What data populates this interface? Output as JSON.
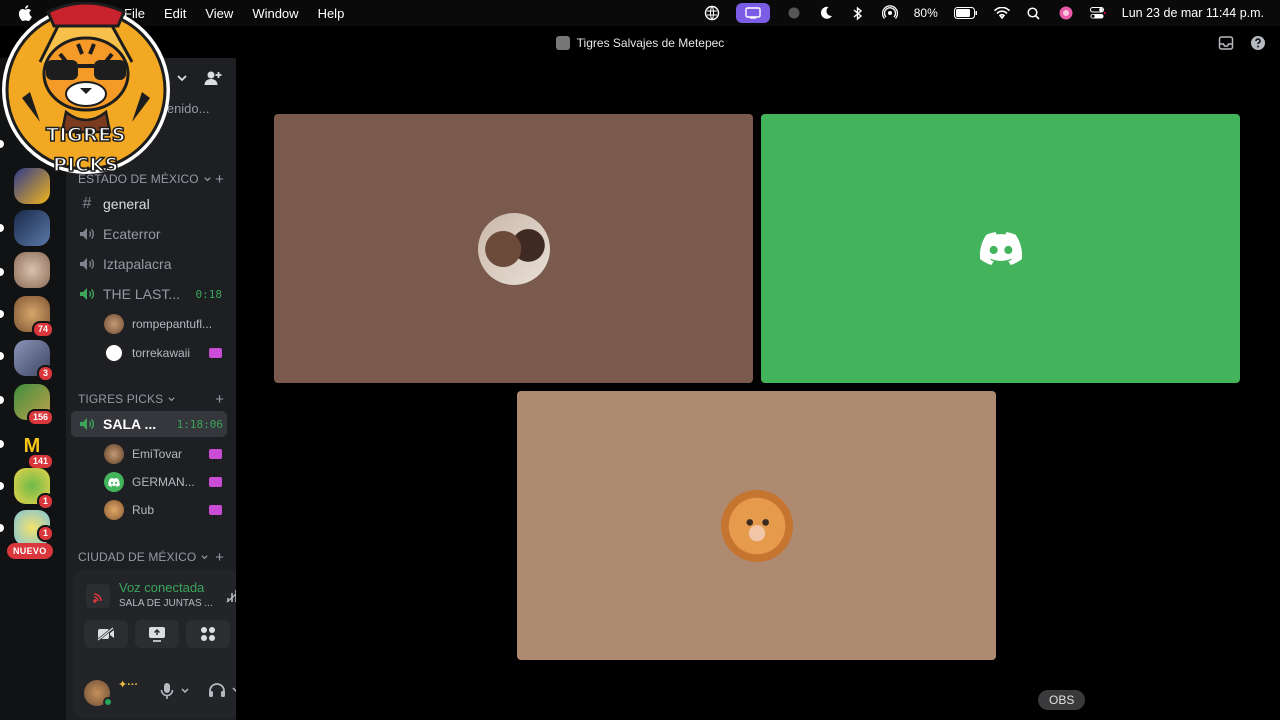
{
  "menubar": {
    "menus": [
      "File",
      "Edit",
      "View",
      "Window",
      "Help"
    ],
    "battery": "80%",
    "datetime": "Lun 23 de mar  11:44 p.m."
  },
  "window": {
    "title": "Tigres Salvajes de Metepec"
  },
  "logo": {
    "text": "TIGRES PICKS"
  },
  "guilds": {
    "badges": [
      "74",
      "3",
      "156",
      "141",
      "1",
      "1"
    ],
    "new_label": "NUEVO"
  },
  "sidebar": {
    "header_partial": "...enido...",
    "categories": {
      "estado": "ESTADO DE MÉXICO",
      "tigres": "TIGRES PICKS",
      "ciudad": "CIUDAD DE MÉXICO"
    },
    "channels": [
      {
        "name": "general",
        "type": "text"
      },
      {
        "name": "Ecaterror",
        "type": "voice"
      },
      {
        "name": "Iztapalacra",
        "type": "voice"
      },
      {
        "name": "THE LAST...",
        "type": "voice",
        "timer": "0:18"
      }
    ],
    "last_users": [
      {
        "name": "rompepantufl..."
      },
      {
        "name": "torrekawaii"
      }
    ],
    "sala": {
      "name": "SALA ...",
      "timer": "1:18:06"
    },
    "sala_users": [
      {
        "name": "EmiTovar"
      },
      {
        "name": "GERMAN..."
      },
      {
        "name": "Rub"
      }
    ]
  },
  "voice_panel": {
    "title": "Voz conectada",
    "subtitle": "SALA DE JUNTAS ..."
  },
  "main": {
    "tile_colors": [
      "#7a5a4c",
      "#43b45c",
      "#ad8a70"
    ],
    "obs_label": "OBS"
  },
  "colors": {
    "discord_green": "#43b45c",
    "brand_blurple": "#5865f2",
    "accent_purple": "#7b5ce5"
  }
}
